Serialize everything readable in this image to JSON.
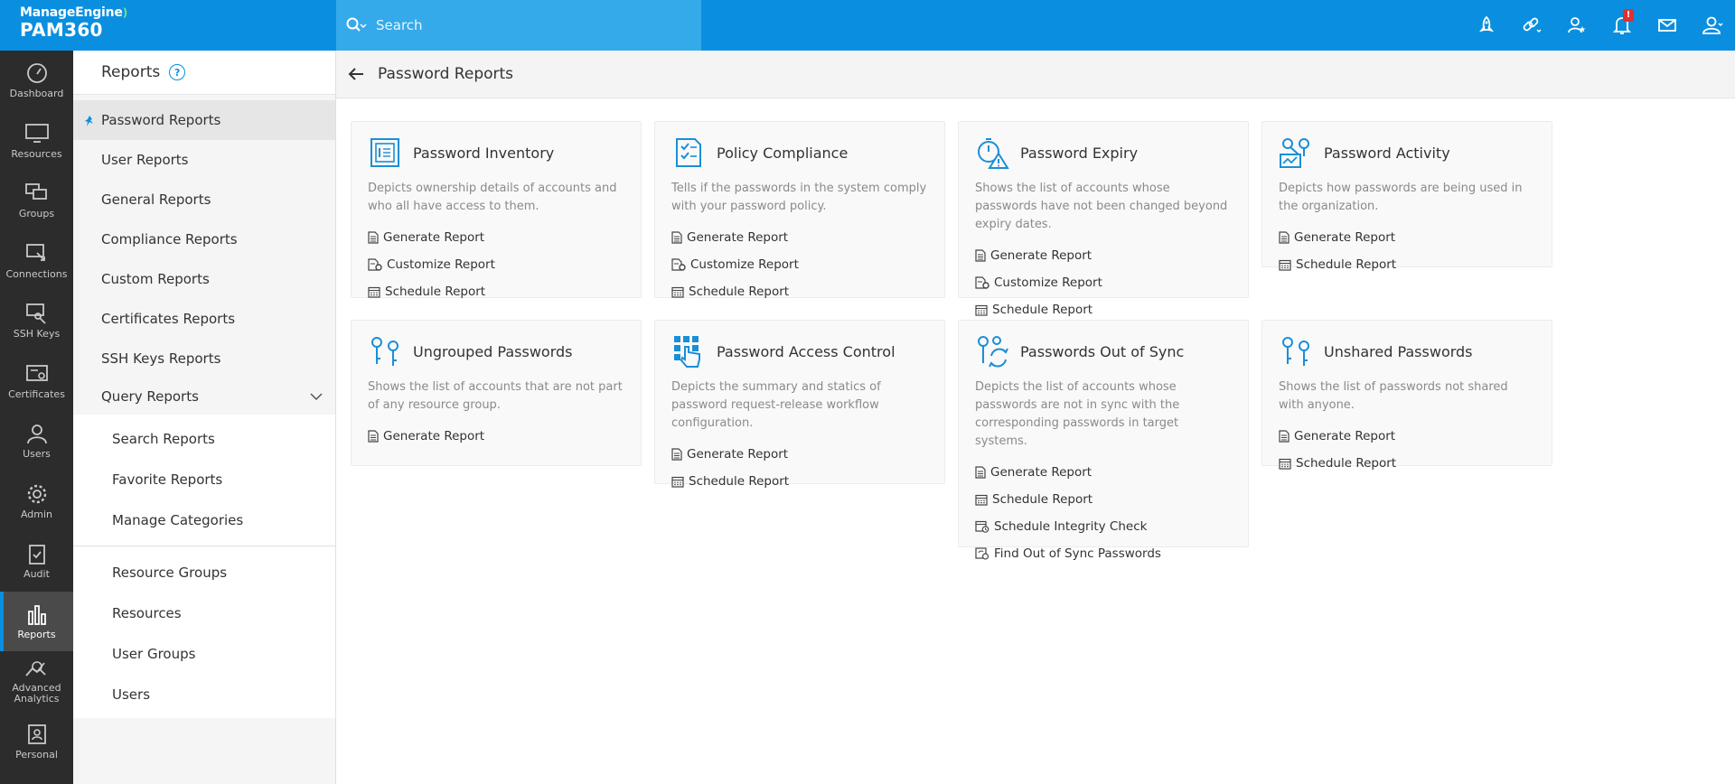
{
  "brand": {
    "top": "ManageEngine",
    "bottom": "PAM360"
  },
  "search": {
    "placeholder": "Search"
  },
  "topbar": {
    "notification_count": "!"
  },
  "rail": [
    {
      "label": "Dashboard",
      "icon": "gauge-icon"
    },
    {
      "label": "Resources",
      "icon": "monitor-icon"
    },
    {
      "label": "Groups",
      "icon": "group-icon"
    },
    {
      "label": "Connections",
      "icon": "connection-icon"
    },
    {
      "label": "SSH Keys",
      "icon": "key-icon"
    },
    {
      "label": "Certificates",
      "icon": "certificate-icon"
    },
    {
      "label": "Users",
      "icon": "user-icon"
    },
    {
      "label": "Admin",
      "icon": "gear-icon"
    },
    {
      "label": "Audit",
      "icon": "clipboard-icon"
    },
    {
      "label": "Reports",
      "icon": "bar-chart-icon"
    },
    {
      "label": "Advanced Analytics",
      "icon": "analytics-icon"
    },
    {
      "label": "Personal",
      "icon": "personal-icon"
    }
  ],
  "sidebar": {
    "title": "Reports",
    "items": [
      "Password Reports",
      "User Reports",
      "General Reports",
      "Compliance Reports",
      "Custom Reports",
      "Certificates Reports",
      "SSH Keys Reports",
      "Query Reports"
    ],
    "query_sub": [
      "Search Reports",
      "Favorite Reports",
      "Manage Categories"
    ],
    "other_sub": [
      "Resource Groups",
      "Resources",
      "User Groups",
      "Users"
    ]
  },
  "page": {
    "title": "Password Reports"
  },
  "actions": {
    "generate": "Generate Report",
    "customize": "Customize Report",
    "schedule": "Schedule Report",
    "integrity": "Schedule Integrity Check",
    "find_sync": "Find Out of Sync Passwords"
  },
  "cards": [
    {
      "title": "Password Inventory",
      "desc": "Depicts ownership details of accounts and who all have access to them."
    },
    {
      "title": "Policy Compliance",
      "desc": "Tells if the passwords in the system comply with your password policy."
    },
    {
      "title": "Password Expiry",
      "desc": "Shows the list of accounts whose passwords have not been changed beyond expiry dates."
    },
    {
      "title": "Password Activity",
      "desc": "Depicts how passwords are being used in the organization."
    },
    {
      "title": "Ungrouped Passwords",
      "desc": "Shows the list of accounts that are not part of any resource group."
    },
    {
      "title": "Password Access Control",
      "desc": "Depicts the summary and statics of password request-release workflow configuration."
    },
    {
      "title": "Passwords Out of Sync",
      "desc": "Depicts the list of accounts whose passwords are not in sync with the corresponding passwords in target systems."
    },
    {
      "title": "Unshared Passwords",
      "desc": "Shows the list of passwords not shared with anyone."
    }
  ],
  "colors": {
    "primary": "#0a8fe0",
    "rail_bg": "#2c2c2c",
    "sidebar_bg": "#f5f5f5"
  }
}
